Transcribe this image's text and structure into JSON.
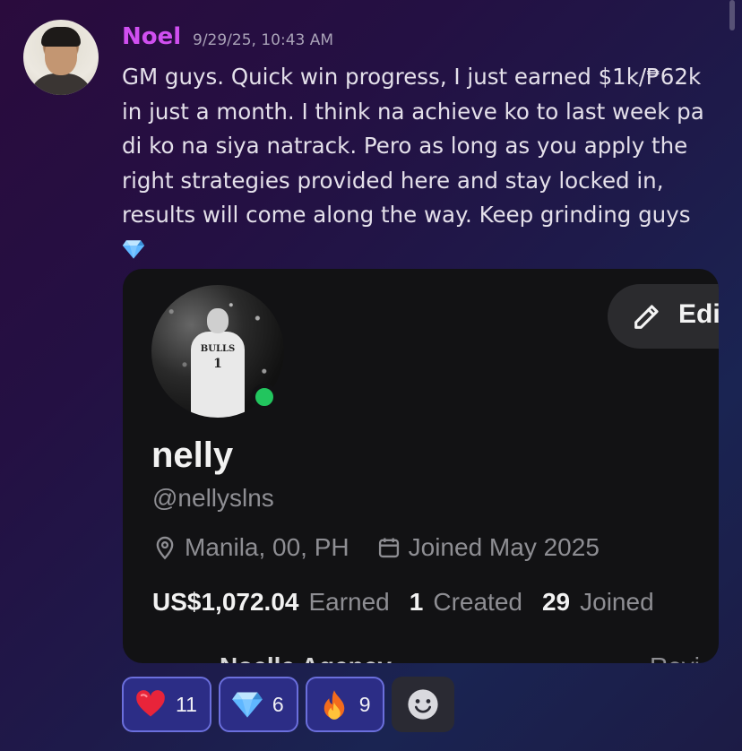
{
  "message": {
    "author": "Noel",
    "timestamp": "9/29/25, 10:43 AM",
    "text": "GM guys. Quick win progress, I just earned $1k/₱62k in just a month. I think na achieve ko to last week pa di ko na siya natrack. Pero as long as you apply the right strategies provided here and stay locked in, results will come along the way. Keep grinding guys",
    "trailing_emoji": "gem-icon"
  },
  "profile_card": {
    "display_name": "nelly",
    "handle": "@nellyslns",
    "edit_label": "Edi",
    "location": "Manila, 00, PH",
    "joined": "Joined May 2025",
    "status": "online",
    "jersey_team": "BULLS",
    "jersey_number": "1",
    "stats": {
      "earned_value": "US$1,072.04",
      "earned_label": "Earned",
      "created_value": "1",
      "created_label": "Created",
      "joined_value": "29",
      "joined_label": "Joined"
    },
    "partial_left": "Noelle Agency",
    "partial_right": "Revi"
  },
  "reactions": [
    {
      "icon": "heart-icon",
      "count": "11"
    },
    {
      "icon": "gem-icon",
      "count": "6"
    },
    {
      "icon": "fire-icon",
      "count": "9"
    }
  ],
  "add_reaction_icon": "smiley-icon",
  "colors": {
    "username": "#d04ff0",
    "reaction_bg": "#2c2d86",
    "reaction_border": "#6b6fdc",
    "online": "#22c55e"
  }
}
